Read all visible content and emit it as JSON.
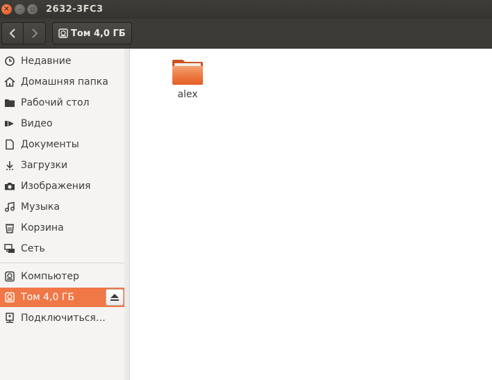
{
  "window": {
    "title": "2632-3FC3"
  },
  "toolbar": {
    "location": "Том 4,0 ГБ"
  },
  "sidebar": {
    "places": [
      {
        "label": "Недавние",
        "icon": "clock-icon"
      },
      {
        "label": "Домашняя папка",
        "icon": "home-icon"
      },
      {
        "label": "Рабочий стол",
        "icon": "desktop-folder-icon"
      },
      {
        "label": "Видео",
        "icon": "video-icon"
      },
      {
        "label": "Документы",
        "icon": "document-icon"
      },
      {
        "label": "Загрузки",
        "icon": "download-icon"
      },
      {
        "label": "Изображения",
        "icon": "camera-icon"
      },
      {
        "label": "Музыка",
        "icon": "music-icon"
      },
      {
        "label": "Корзина",
        "icon": "trash-icon"
      },
      {
        "label": "Сеть",
        "icon": "network-icon"
      }
    ],
    "devices": [
      {
        "label": "Компьютер",
        "icon": "drive-icon"
      },
      {
        "label": "Том 4,0 ГБ",
        "icon": "drive-icon",
        "active": true
      },
      {
        "label": "Подключиться…",
        "icon": "server-icon"
      }
    ]
  },
  "content": {
    "items": [
      {
        "label": "alex",
        "icon": "folder-icon"
      }
    ]
  },
  "colors": {
    "accent": "#f07746",
    "titlebar": "#3c3b37",
    "sidebar": "#f5f4f2"
  }
}
